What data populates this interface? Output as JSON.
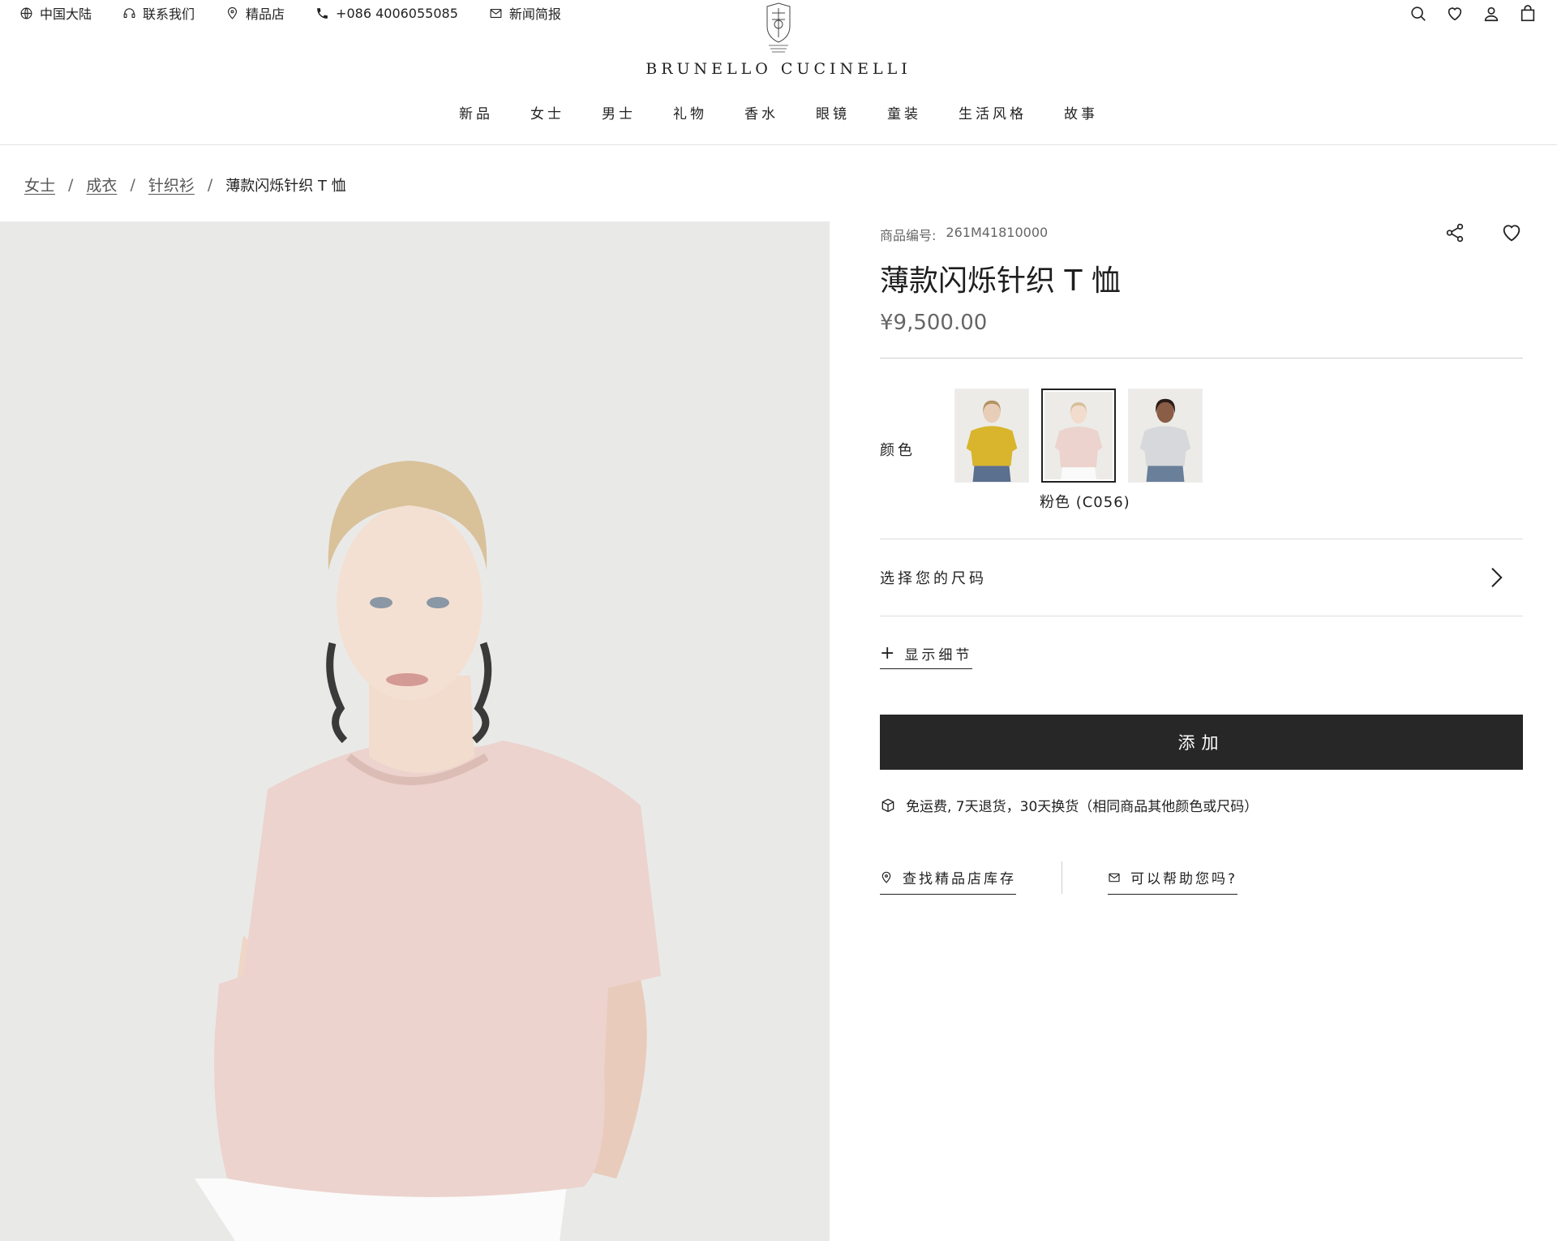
{
  "utility": {
    "region": "中国大陆",
    "contact": "联系我们",
    "stores": "精品店",
    "phone": "+086 4006055085",
    "newsletter": "新闻简报"
  },
  "brand": {
    "name": "BRUNELLO CUCINELLI"
  },
  "header_icons": [
    "search-icon",
    "heart-icon",
    "user-icon",
    "bag-icon"
  ],
  "nav": {
    "items": [
      "新品",
      "女士",
      "男士",
      "礼物",
      "香水",
      "眼镜",
      "童装",
      "生活风格",
      "故事"
    ]
  },
  "breadcrumb": {
    "items": [
      "女士",
      "成衣",
      "针织衫"
    ],
    "current": "薄款闪烁针织 T 恤"
  },
  "product": {
    "sku_label": "商品编号:",
    "sku": "261M41810000",
    "title": "薄款闪烁针织 T 恤",
    "price": "¥9,500.00",
    "color_label": "颜色",
    "selected_color": "粉色 (C056)",
    "swatch_colors": [
      "#d8b52c",
      "#ecd3cd",
      "#d6d8dc"
    ],
    "size_label": "选择您的尺码",
    "details_label": "显示细节",
    "add_button": "添加",
    "shipping_note": "免运费, 7天退货，30天换货（相同商品其他颜色或尺码）",
    "find_store": "查找精品店库存",
    "help": "可以帮助您吗?"
  },
  "colors": {
    "button_bg": "#272727",
    "shirt_pink": "#ecd3cd",
    "background": "#e9eae8"
  }
}
